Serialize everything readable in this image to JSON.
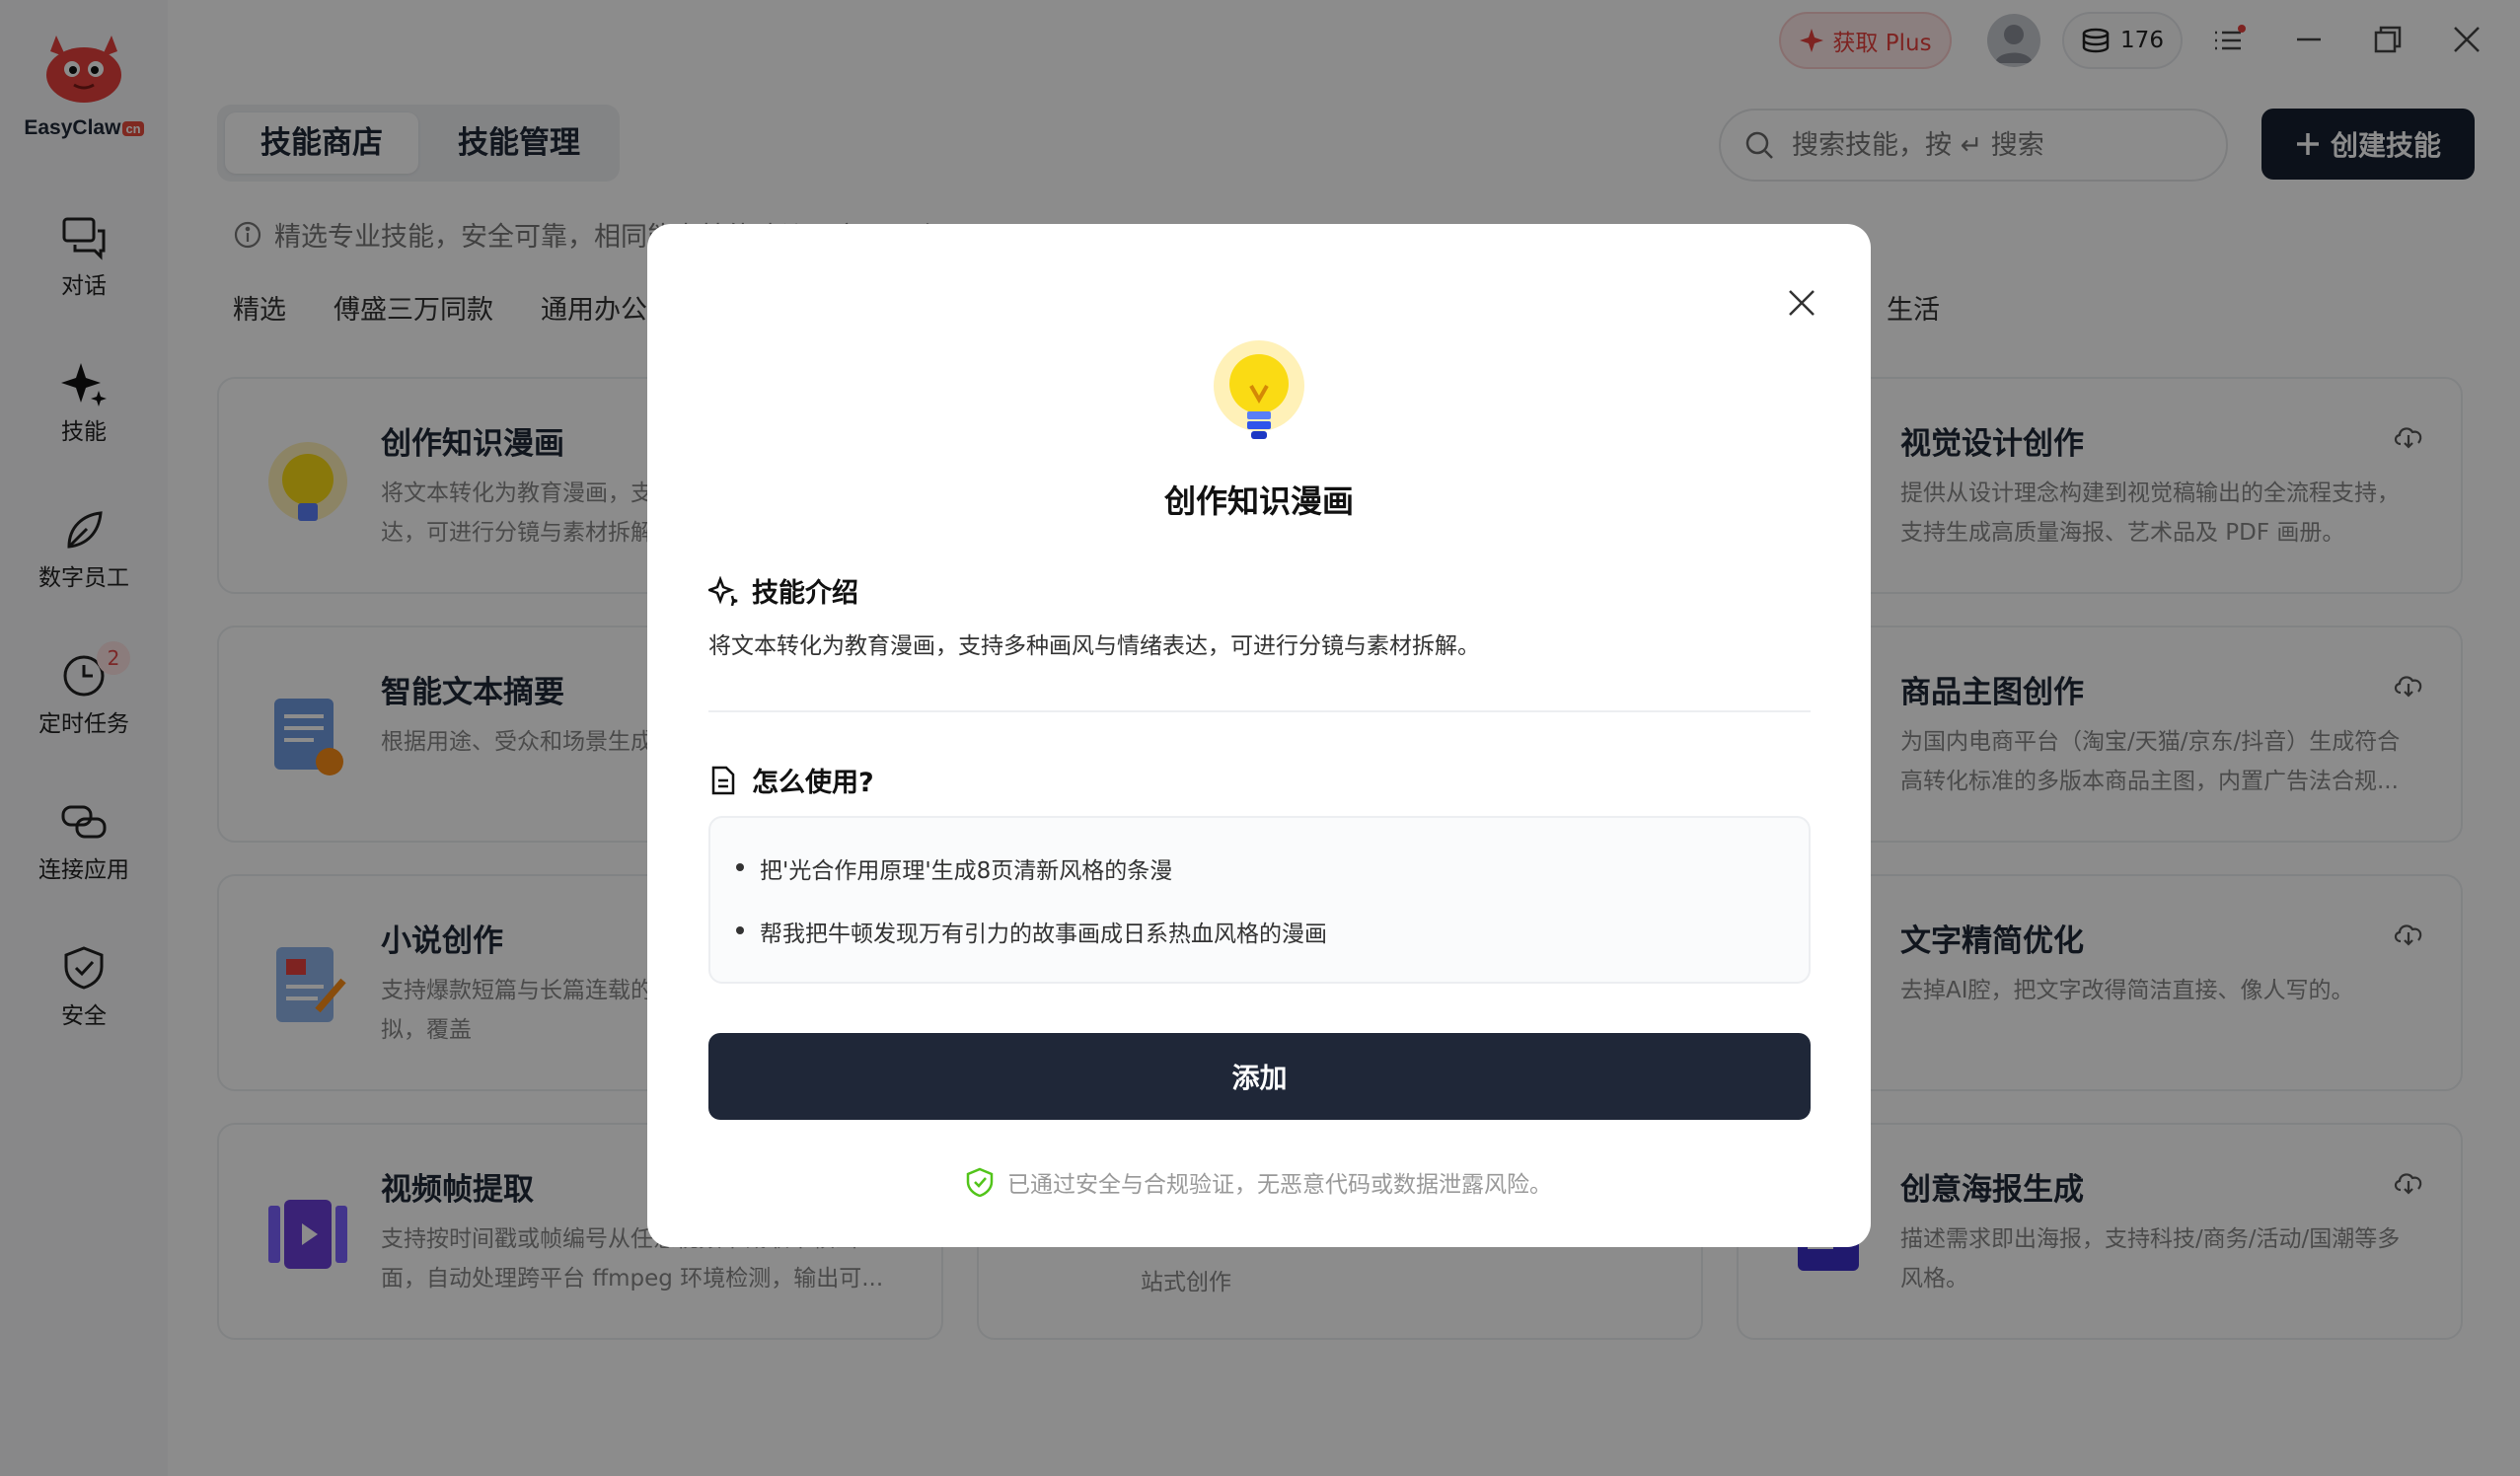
{
  "app": {
    "brand": "EasyClaw",
    "brand_suffix": "cn"
  },
  "sidebar": {
    "items": [
      {
        "label": "对话",
        "icon": "chat-icon"
      },
      {
        "label": "技能",
        "icon": "sparkle-icon"
      },
      {
        "label": "数字员工",
        "icon": "leaf-icon"
      },
      {
        "label": "定时任务",
        "icon": "clock-icon",
        "badge": "2"
      },
      {
        "label": "连接应用",
        "icon": "link-icon"
      },
      {
        "label": "安全",
        "icon": "shield-icon"
      }
    ]
  },
  "topbar": {
    "plus_label": "获取 Plus",
    "credits": "176"
  },
  "tabs": [
    {
      "label": "技能商店",
      "active": true
    },
    {
      "label": "技能管理",
      "active": false
    }
  ],
  "search": {
    "placeholder": "搜索技能，按 ↵ 搜索"
  },
  "create_label": "创建技能",
  "notice": "精选专业技能，安全可靠，相同能力技能建议只启用一个",
  "categories": [
    "精选",
    "傅盛三万同款",
    "通用办公"
  ],
  "category_last": "生活",
  "cards": [
    {
      "title": "创作知识漫画",
      "desc": "将文本转化为教育漫画，支持多种画风与情绪表达，可进行分镜与素材拆解。"
    },
    {
      "title": "视觉设计创作",
      "desc": "提供从设计理念构建到视觉稿输出的全流程支持，支持生成高质量海报、艺术品及 PDF 画册。"
    },
    {
      "title": "智能文本摘要",
      "desc": "根据用途、受众和场景生成"
    },
    {
      "title": "商品主图创作",
      "desc": "为国内电商平台（淘宝/天猫/京东/抖音）生成符合高转化标准的多版本商品主图，内置广告法合规..."
    },
    {
      "title": "小说创作",
      "desc": "支持爆款短篇与长篇连载的创作，龙等名家风格模拟，覆盖"
    },
    {
      "title": "文字精简优化",
      "desc": "去掉AI腔，把文字改得简洁直接、像人写的。"
    },
    {
      "title": "视频帧提取",
      "desc": "支持按时间戳或帧编号从任意视频中截取单帧画面，自动处理跨平台 ffmpeg 环境检测，输出可..."
    },
    {
      "title": "",
      "desc": "站式创作"
    },
    {
      "title": "创意海报生成",
      "desc": "描述需求即出海报，支持科技/商务/活动/国潮等多风格。"
    }
  ],
  "modal": {
    "title": "创作知识漫画",
    "intro_heading": "技能介绍",
    "intro_text": "将文本转化为教育漫画，支持多种画风与情绪表达，可进行分镜与素材拆解。",
    "usage_heading": "怎么使用?",
    "examples": [
      "把'光合作用原理'生成8页清新风格的条漫",
      "帮我把牛顿发现万有引力的故事画成日系热血风格的漫画"
    ],
    "add_label": "添加",
    "safety_text": "已通过安全与合规验证，无恶意代码或数据泄露风险。"
  },
  "colors": {
    "primary": "#1f2738",
    "accent_red": "#e5413d",
    "safe_green": "#52c41a"
  }
}
